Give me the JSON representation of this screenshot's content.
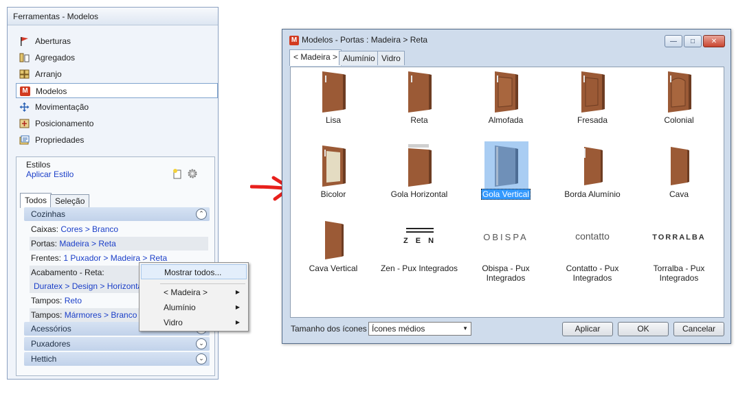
{
  "tools_panel": {
    "title": "Ferramentas - Modelos",
    "items": [
      {
        "label": "Aberturas",
        "icon": "aberturas-flag-icon"
      },
      {
        "label": "Agregados",
        "icon": "agregados-icon"
      },
      {
        "label": "Arranjo",
        "icon": "arranjo-icon"
      },
      {
        "label": "Modelos",
        "icon": "modelos-m-icon",
        "selected": true
      },
      {
        "label": "Movimentação",
        "icon": "move-arrows-icon"
      },
      {
        "label": "Posicionamento",
        "icon": "posicionamento-icon"
      },
      {
        "label": "Propriedades",
        "icon": "propriedades-icon"
      }
    ],
    "estilos": {
      "heading": "Estilos",
      "apply_link": "Aplicar Estilo",
      "tabs": [
        "Todos",
        "Seleção"
      ],
      "groups": {
        "cozinhas": "Cozinhas",
        "acessorios": "Acessórios",
        "puxadores": "Puxadores",
        "hettich": "Hettich"
      },
      "rows": {
        "caixas_label": "Caixas:",
        "caixas_value": "Cores > Branco",
        "portas_label": "Portas:",
        "portas_value": "Madeira > Reta",
        "frentes_label": "Frentes:",
        "frentes_value": "1 Puxador > Madeira > Reta",
        "acabamento_label": "Acabamento - Reta:",
        "acabamento_value": "Duratex > Design > Horizontal",
        "tampos1_label": "Tampos:",
        "tampos1_value": "Reto",
        "tampos2_label": "Tampos:",
        "tampos2_value": "Mármores > Branco >"
      }
    }
  },
  "context_menu": {
    "items": [
      "Mostrar todos...",
      "< Madeira >",
      "Alumínio",
      "Vidro"
    ]
  },
  "models_window": {
    "title": "Modelos - Portas : Madeira > Reta",
    "logo_letter": "M",
    "tabs": [
      "< Madeira >",
      "Alumínio",
      "Vidro"
    ],
    "items": [
      "Lisa",
      "Reta",
      "Almofada",
      "Fresada",
      "Colonial",
      "Bicolor",
      "Gola Horizontal",
      "Gola Vertical",
      "Borda Alumínio",
      "Cava",
      "Cava Vertical",
      "Zen - Pux Integrados",
      "Obispa - Pux Integrados",
      "Contatto - Pux Integrados",
      "Torralba - Pux Integrados"
    ],
    "selected_item": "Gola Vertical",
    "brand_logos": {
      "zen": "Z E N",
      "obispa": "OBISPA",
      "contatto": "contatto",
      "torralba": "TORRALBA"
    },
    "icon_size_label": "Tamanho dos ícones",
    "icon_size_value": "Ícones médios",
    "buttons": {
      "apply": "Aplicar",
      "ok": "OK",
      "cancel": "Cancelar"
    }
  },
  "colors": {
    "wood": "#9b5a36",
    "selection": "#3399ff",
    "link": "#1a3ec8",
    "arrow": "#e8201c"
  }
}
